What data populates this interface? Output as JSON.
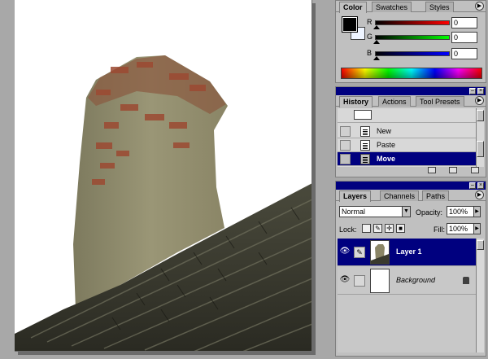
{
  "color_palette": {
    "tabs": [
      "Color",
      "Swatches",
      "Styles"
    ],
    "channels": [
      {
        "label": "R",
        "value": "0",
        "color": "#e00000"
      },
      {
        "label": "G",
        "value": "0",
        "color": "#00c000"
      },
      {
        "label": "B",
        "value": "0",
        "color": "#0000e0"
      }
    ],
    "foreground": "#000000",
    "background": "#eef4ff"
  },
  "history_palette": {
    "tabs": [
      "History",
      "Actions",
      "Tool Presets"
    ],
    "items": [
      {
        "label": "New",
        "selected": false
      },
      {
        "label": "Paste",
        "selected": false
      },
      {
        "label": "Move",
        "selected": true
      }
    ]
  },
  "layers_palette": {
    "tabs": [
      "Layers",
      "Channels",
      "Paths"
    ],
    "blend_mode": "Normal",
    "opacity_label": "Opacity:",
    "opacity": "100%",
    "lock_label": "Lock:",
    "fill_label": "Fill:",
    "fill": "100%",
    "layers": [
      {
        "name": "Layer 1",
        "selected": true
      },
      {
        "name": "Background",
        "selected": false,
        "locked": true
      }
    ]
  },
  "accent": "#00007f"
}
